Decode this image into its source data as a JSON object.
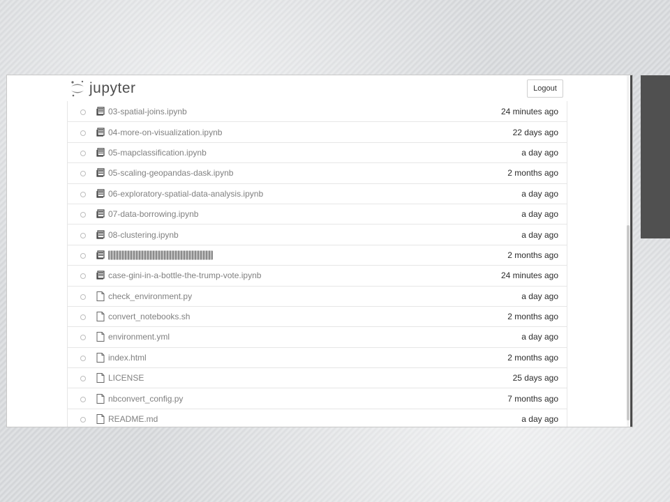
{
  "app": {
    "logo_text": "jupyter",
    "logout_label": "Logout"
  },
  "files": [
    {
      "name": "03-spatial-joins.ipynb",
      "modified": "24 minutes ago",
      "icon": "notebook-icon"
    },
    {
      "name": "04-more-on-visualization.ipynb",
      "modified": "22 days ago",
      "icon": "notebook-icon"
    },
    {
      "name": "05-mapclassification.ipynb",
      "modified": "a day ago",
      "icon": "notebook-icon"
    },
    {
      "name": "05-scaling-geopandas-dask.ipynb",
      "modified": "2 months ago",
      "icon": "notebook-icon"
    },
    {
      "name": "06-exploratory-spatial-data-analysis.ipynb",
      "modified": "a day ago",
      "icon": "notebook-icon"
    },
    {
      "name": "07-data-borrowing.ipynb",
      "modified": "a day ago",
      "icon": "notebook-icon"
    },
    {
      "name": "08-clustering.ipynb",
      "modified": "a day ago",
      "icon": "notebook-icon"
    },
    {
      "name": "",
      "modified": "2 months ago",
      "icon": "notebook-icon",
      "selected": true
    },
    {
      "name": "case-gini-in-a-bottle-the-trump-vote.ipynb",
      "modified": "24 minutes ago",
      "icon": "notebook-icon"
    },
    {
      "name": "check_environment.py",
      "modified": "a day ago",
      "icon": "file-icon"
    },
    {
      "name": "convert_notebooks.sh",
      "modified": "2 months ago",
      "icon": "file-icon"
    },
    {
      "name": "environment.yml",
      "modified": "a day ago",
      "icon": "file-icon"
    },
    {
      "name": "index.html",
      "modified": "2 months ago",
      "icon": "file-icon"
    },
    {
      "name": "LICENSE",
      "modified": "25 days ago",
      "icon": "file-icon"
    },
    {
      "name": "nbconvert_config.py",
      "modified": "7 months ago",
      "icon": "file-icon"
    },
    {
      "name": "README.md",
      "modified": "a day ago",
      "icon": "file-icon"
    }
  ]
}
